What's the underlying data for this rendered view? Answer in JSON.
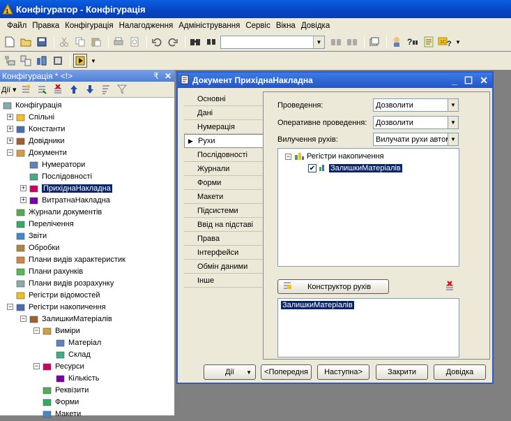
{
  "window": {
    "title": "Конфігуратор - Конфігурація"
  },
  "menu": [
    "Файл",
    "Правка",
    "Конфігурація",
    "Налагодження",
    "Адміністрування",
    "Сервіс",
    "Вікна",
    "Довідка"
  ],
  "toolbar": {
    "search_value": ""
  },
  "config_panel": {
    "title": "Конфігурація * <!>",
    "pin": "₹",
    "actions_label": "Дії",
    "tree": [
      {
        "label": "Конфігурація",
        "level": 0
      },
      {
        "label": "Спільні",
        "level": 1
      },
      {
        "label": "Константи",
        "level": 1
      },
      {
        "label": "Довідники",
        "level": 1
      },
      {
        "label": "Документи",
        "level": 1
      },
      {
        "label": "Нумератори",
        "level": 2
      },
      {
        "label": "Послідовності",
        "level": 2
      },
      {
        "label": "ПрихіднаНакладна",
        "level": 2,
        "selected": true
      },
      {
        "label": "ВитратнаНакладна",
        "level": 2
      },
      {
        "label": "Журнали документів",
        "level": 1
      },
      {
        "label": "Перелічення",
        "level": 1
      },
      {
        "label": "Звіти",
        "level": 1
      },
      {
        "label": "Обробки",
        "level": 1
      },
      {
        "label": "Плани видів характеристик",
        "level": 1
      },
      {
        "label": "Плани рахунків",
        "level": 1
      },
      {
        "label": "Плани видів розрахунку",
        "level": 1
      },
      {
        "label": "Регістри відомостей",
        "level": 1
      },
      {
        "label": "Регістри накопичення",
        "level": 1
      },
      {
        "label": "ЗалишкиМатеріалів",
        "level": 2
      },
      {
        "label": "Виміри",
        "level": 3
      },
      {
        "label": "Матеріал",
        "level": 4
      },
      {
        "label": "Склад",
        "level": 4
      },
      {
        "label": "Ресурси",
        "level": 3
      },
      {
        "label": "Кількість",
        "level": 4
      },
      {
        "label": "Реквізити",
        "level": 3
      },
      {
        "label": "Форми",
        "level": 3
      },
      {
        "label": "Макети",
        "level": 3
      }
    ]
  },
  "dialog": {
    "title": "Документ ПрихіднаНакладна",
    "tabs": [
      "Основні",
      "Дані",
      "Нумерація",
      "Рухи",
      "Послідовності",
      "Журнали",
      "Форми",
      "Макети",
      "Підсистеми",
      "Ввід на підставі",
      "Права",
      "Інтерфейси",
      "Обмін даними",
      "Інше"
    ],
    "active_tab": "Рухи",
    "fields": {
      "posting_label": "Проведення:",
      "posting_value": "Дозволити",
      "realtime_label": "Оперативне проведення:",
      "realtime_value": "Дозволити",
      "deletion_label": "Вилучення рухів:",
      "deletion_value": "Вилучати рухи автом"
    },
    "registers_tree": {
      "root": "Регістри накопичення",
      "child": "ЗалишкиМатеріалів"
    },
    "constructor_button": "Конструктор рухів",
    "movements_list": [
      "ЗалишкиМатеріалів"
    ],
    "buttons": {
      "actions": "Дії",
      "prev": "<Попередня",
      "next": "Наступна>",
      "close": "Закрити",
      "help": "Довідка"
    }
  }
}
